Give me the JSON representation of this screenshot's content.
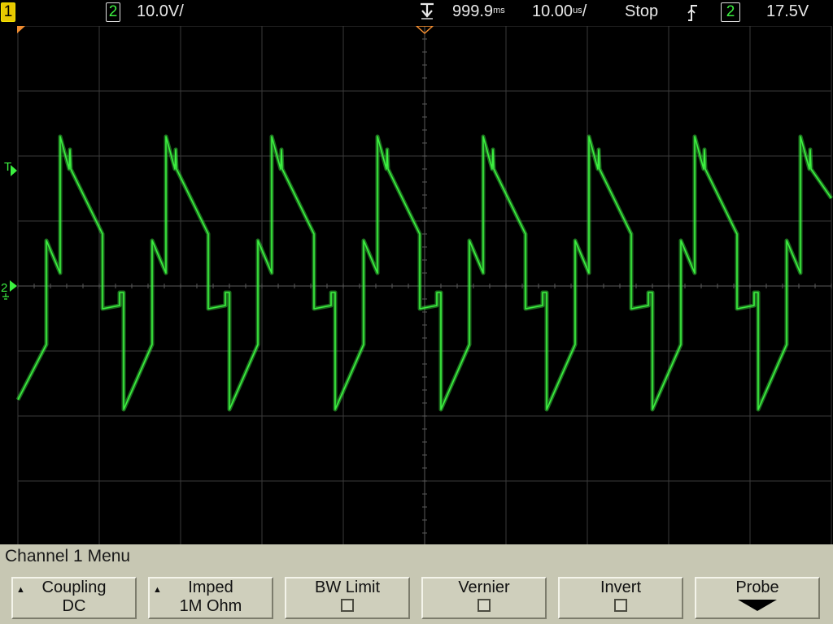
{
  "status_bar": {
    "ch1_label": "1",
    "ch2_label": "2",
    "ch2_scale": "10.0V/",
    "time_offset": "999.9",
    "time_offset_unit": "ms",
    "time_base": "10.00",
    "time_base_unit": "us",
    "time_base_suffix": "/",
    "run_state": "Stop",
    "trigger_slope_icon": "rising-edge-icon",
    "trigger_channel": "2",
    "trigger_level": "17.5V"
  },
  "screen": {
    "trigger_level_marker": "T",
    "ch2_ground_marker": "2"
  },
  "menu": {
    "title": "Channel 1  Menu",
    "softkeys": [
      {
        "label": "Coupling",
        "value": "DC",
        "kind": "select"
      },
      {
        "label": "Imped",
        "value": "1M Ohm",
        "kind": "select"
      },
      {
        "label": "BW Limit",
        "value": "",
        "kind": "checkbox",
        "checked": false
      },
      {
        "label": "Vernier",
        "value": "",
        "kind": "checkbox",
        "checked": false
      },
      {
        "label": "Invert",
        "value": "",
        "kind": "checkbox",
        "checked": false
      },
      {
        "label": "Probe",
        "value": "",
        "kind": "submenu"
      }
    ]
  },
  "colors": {
    "background": "#000000",
    "graticule": "#3a3a3a",
    "channel1": "#e8c800",
    "channel2": "#3cf040",
    "menu_bg": "#c7c7b3",
    "trigger_marker": "#f08c30"
  },
  "chart_data": {
    "type": "line",
    "title": "",
    "xlabel": "",
    "ylabel": "",
    "grid": true,
    "divisions": {
      "x": 10,
      "y": 8
    },
    "time_per_div": "10.00us",
    "volts_per_div": "10.0V",
    "xlim": [
      -50,
      50
    ],
    "ylim": [
      -40,
      40
    ],
    "x_unit": "us",
    "y_unit": "V",
    "period_us": 13.0,
    "series": [
      {
        "channel": 2,
        "color": "#3cf040",
        "x": [
          -50.0,
          -46.5,
          -46.5,
          -44.8,
          -44.8,
          -43.7,
          -43.7,
          -43.6,
          -43.5,
          -39.6,
          -39.6,
          -37.5,
          -37.5,
          -37.0,
          -37.0,
          -33.5,
          -33.5,
          -31.8,
          -31.8,
          -30.7,
          -30.7,
          -30.6,
          -30.5,
          -26.6,
          -26.6,
          -24.5,
          -24.5,
          -24.0,
          -24.0,
          -20.5,
          -20.5,
          -18.8,
          -18.8,
          -17.7,
          -17.7,
          -17.6,
          -17.5,
          -13.6,
          -13.6,
          -11.5,
          -11.5,
          -11.0,
          -11.0,
          -7.5,
          -7.5,
          -5.8,
          -5.8,
          -4.7,
          -4.7,
          -4.6,
          -4.5,
          -0.6,
          -0.6,
          1.5,
          1.5,
          2.0,
          2.0,
          5.5,
          5.5,
          7.2,
          7.2,
          8.3,
          8.3,
          8.4,
          8.5,
          12.4,
          12.4,
          14.5,
          14.5,
          15.0,
          15.0,
          18.5,
          18.5,
          20.2,
          20.2,
          21.3,
          21.3,
          21.4,
          21.5,
          25.4,
          25.4,
          27.5,
          27.5,
          28.0,
          28.0,
          31.5,
          31.5,
          33.2,
          33.2,
          34.3,
          34.3,
          34.4,
          34.5,
          38.4,
          38.4,
          40.5,
          40.5,
          41.0,
          41.0,
          44.5,
          44.5,
          46.2,
          46.2,
          47.3,
          47.3,
          47.4,
          47.5,
          50.0
        ],
        "y": [
          -17.5,
          -9.0,
          7.0,
          2.0,
          23.0,
          18.0,
          18.0,
          21.0,
          18.0,
          8.0,
          -3.5,
          -3.0,
          -1.0,
          -1.0,
          -19.0,
          -9.0,
          7.0,
          2.0,
          23.0,
          18.0,
          18.0,
          21.0,
          18.0,
          8.0,
          -3.5,
          -3.0,
          -1.0,
          -1.0,
          -19.0,
          -9.0,
          7.0,
          2.0,
          23.0,
          18.0,
          18.0,
          21.0,
          18.0,
          8.0,
          -3.5,
          -3.0,
          -1.0,
          -1.0,
          -19.0,
          -9.0,
          7.0,
          2.0,
          23.0,
          18.0,
          18.0,
          21.0,
          18.0,
          8.0,
          -3.5,
          -3.0,
          -1.0,
          -1.0,
          -19.0,
          -9.0,
          7.0,
          2.0,
          23.0,
          18.0,
          18.0,
          21.0,
          18.0,
          8.0,
          -3.5,
          -3.0,
          -1.0,
          -1.0,
          -19.0,
          -9.0,
          7.0,
          2.0,
          23.0,
          18.0,
          18.0,
          21.0,
          18.0,
          8.0,
          -3.5,
          -3.0,
          -1.0,
          -1.0,
          -19.0,
          -9.0,
          7.0,
          2.0,
          23.0,
          18.0,
          18.0,
          21.0,
          18.0,
          8.0,
          -3.5,
          -3.0,
          -1.0,
          -1.0,
          -19.0,
          -9.0,
          7.0,
          2.0,
          23.0,
          18.0,
          18.0,
          21.0,
          18.0,
          13.5
        ]
      }
    ]
  }
}
